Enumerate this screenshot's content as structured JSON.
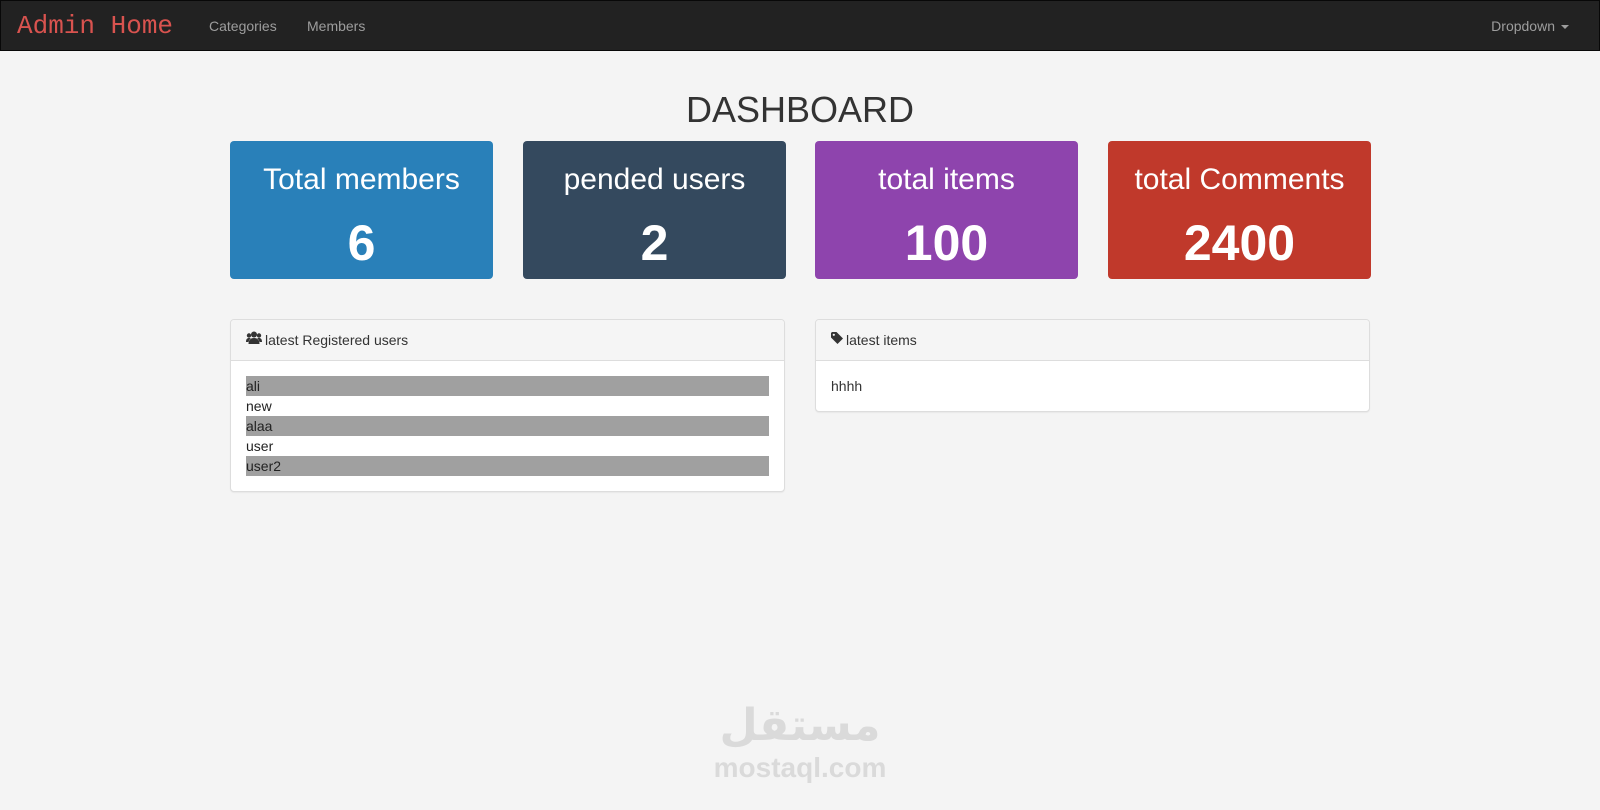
{
  "navbar": {
    "brand": "Admin Home",
    "links": [
      "Categories",
      "Members"
    ],
    "dropdown": "Dropdown"
  },
  "page": {
    "title": "DASHBOARD"
  },
  "stats": [
    {
      "label": "Total members",
      "value": "6",
      "color": "#2980b9"
    },
    {
      "label": "pended users",
      "value": "2",
      "color": "#34495e"
    },
    {
      "label": "total items",
      "value": "100",
      "color": "#8e44ad"
    },
    {
      "label": "total Comments",
      "value": "2400",
      "color": "#c0392b"
    }
  ],
  "users_panel": {
    "icon": "users-icon",
    "heading": "latest Registered users",
    "users": [
      "ali",
      "new",
      "alaa",
      "user",
      "user2"
    ]
  },
  "items_panel": {
    "icon": "tag-icon",
    "heading": "latest items",
    "items": [
      "hhhh"
    ]
  },
  "watermark": {
    "logo_text": "مستقل",
    "text": "mostaql.com"
  }
}
